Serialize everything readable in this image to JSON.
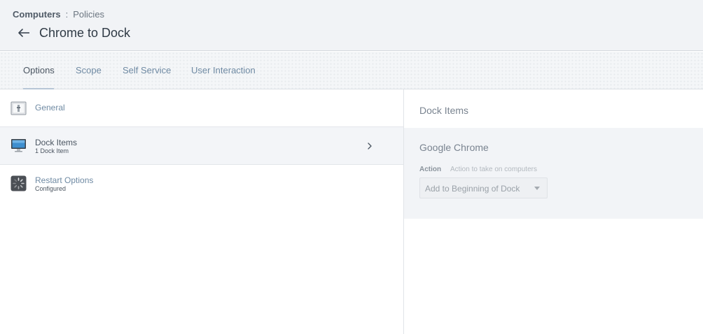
{
  "breadcrumb": {
    "root": "Computers",
    "separator": ":",
    "leaf": "Policies"
  },
  "page": {
    "title": "Chrome to Dock",
    "back_icon": "arrow-left-icon"
  },
  "tabs": [
    {
      "label": "Options",
      "active": true
    },
    {
      "label": "Scope",
      "active": false
    },
    {
      "label": "Self Service",
      "active": false
    },
    {
      "label": "User Interaction",
      "active": false
    }
  ],
  "sections": [
    {
      "title": "General",
      "subtitle": "",
      "icon": "general-settings-icon",
      "selected": false
    },
    {
      "title": "Dock Items",
      "subtitle": "1 Dock Item",
      "icon": "monitor-icon",
      "selected": true
    },
    {
      "title": "Restart Options",
      "subtitle": "Configured",
      "icon": "restart-spinner-icon",
      "selected": false
    }
  ],
  "detail": {
    "heading": "Dock Items",
    "item_name": "Google Chrome",
    "action_label": "Action",
    "action_hint": "Action to take on computers",
    "action_value": "Add to Beginning of Dock"
  },
  "colors": {
    "link": "#6f8aa3",
    "text_dark": "#2f3a45",
    "header_bg": "#f1f3f6",
    "selected_row_bg": "#f3f5f8"
  }
}
